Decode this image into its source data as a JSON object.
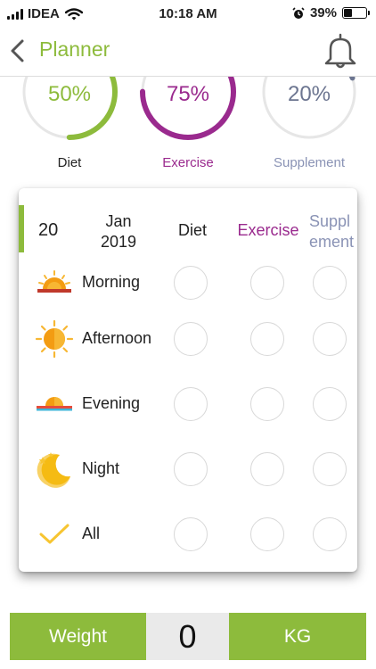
{
  "status": {
    "carrier": "IDEA",
    "time": "10:18 AM",
    "battery": "39%",
    "battery_level": 0.39
  },
  "nav": {
    "title": "Planner"
  },
  "colors": {
    "green": "#8dbb3c",
    "purple": "#9a2a8e",
    "slate": "#6c7590",
    "ring_track": "#e6e6e6"
  },
  "progress": [
    {
      "label": "Diet",
      "percent_text": "50%",
      "value": 50,
      "color": "#8dbb3c",
      "label_color": "#222222"
    },
    {
      "label": "Exercise",
      "percent_text": "75%",
      "value": 75,
      "color": "#9a2a8e",
      "label_color": "#9a2a8e"
    },
    {
      "label": "Supplement",
      "percent_text": "20%",
      "value": 20,
      "color": "#6c7590",
      "label_color": "#8a93b5"
    }
  ],
  "planner": {
    "day": "20",
    "month_line1": "Jan",
    "month_line2": "2019",
    "col_diet": "Diet",
    "col_exercise": "Exercise",
    "col_supplement_line1": "Suppl",
    "col_supplement_line2": "ement",
    "rows": [
      {
        "label": "Morning",
        "icon": "sunrise-icon"
      },
      {
        "label": "Afternoon",
        "icon": "sun-icon"
      },
      {
        "label": "Evening",
        "icon": "sunset-icon"
      },
      {
        "label": "Night",
        "icon": "moon-stars-icon"
      },
      {
        "label": "All",
        "icon": "checkmark-icon"
      }
    ]
  },
  "footer": {
    "weight_label": "Weight",
    "weight_value": "0",
    "unit_label": "KG"
  }
}
